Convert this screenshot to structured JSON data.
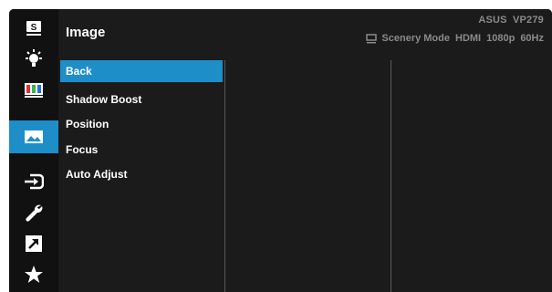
{
  "header": {
    "title": "Image",
    "model": "ASUS  VP279",
    "status": [
      "Scenery Mode",
      "HDMI",
      "1080p",
      "60Hz"
    ]
  },
  "rail": {
    "items": [
      {
        "icon": "splendid-icon",
        "label": "S",
        "active": false
      },
      {
        "icon": "blue-light-filter-icon",
        "active": false
      },
      {
        "icon": "color-icon",
        "active": false
      },
      {
        "icon": "image-icon",
        "active": true
      },
      {
        "icon": "input-select-icon",
        "active": false
      },
      {
        "icon": "system-setup-icon",
        "active": false
      },
      {
        "icon": "shortcut-icon",
        "active": false
      },
      {
        "icon": "favorite-icon",
        "active": false
      }
    ]
  },
  "menu": {
    "items": [
      {
        "label": "Back",
        "selected": true
      },
      {
        "label": "Shadow Boost",
        "selected": false
      },
      {
        "label": "Position",
        "selected": false
      },
      {
        "label": "Focus",
        "selected": false
      },
      {
        "label": "Auto Adjust",
        "selected": false
      }
    ]
  },
  "colors": {
    "accent": "#1e8ec9",
    "background": "#1b1b1b",
    "rail": "#111111",
    "muted_text": "#8a8a8a"
  }
}
